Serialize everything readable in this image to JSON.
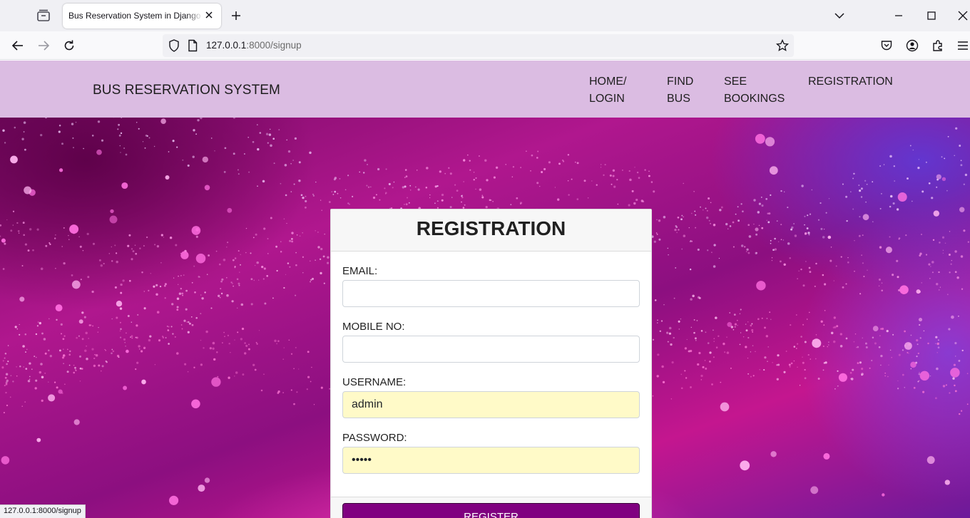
{
  "browser": {
    "tab_title": "Bus Reservation System in Django P",
    "url_host": "127.0.0.1",
    "url_path": ":8000/signup",
    "status_url": "127.0.0.1:8000/signup"
  },
  "site": {
    "brand": "BUS RESERVATION SYSTEM",
    "menu": [
      {
        "line1": "HOME/",
        "line2": "LOGIN"
      },
      {
        "line1": "FIND",
        "line2": "BUS"
      },
      {
        "line1": "SEE",
        "line2": "BOOKINGS"
      },
      {
        "line1": "REGISTRATION",
        "line2": ""
      }
    ]
  },
  "form": {
    "title": "REGISTRATION",
    "email": {
      "label": "EMAIL:",
      "value": ""
    },
    "mobile": {
      "label": "MOBILE NO:",
      "value": ""
    },
    "username": {
      "label": "USERNAME:",
      "value": "admin"
    },
    "password": {
      "label": "PASSWORD:",
      "value": "admin"
    },
    "submit_label": "REGISTER"
  },
  "colors": {
    "header_bg": "#dbbce2",
    "button_bg": "#800080",
    "autofill_bg": "#fffac8"
  }
}
